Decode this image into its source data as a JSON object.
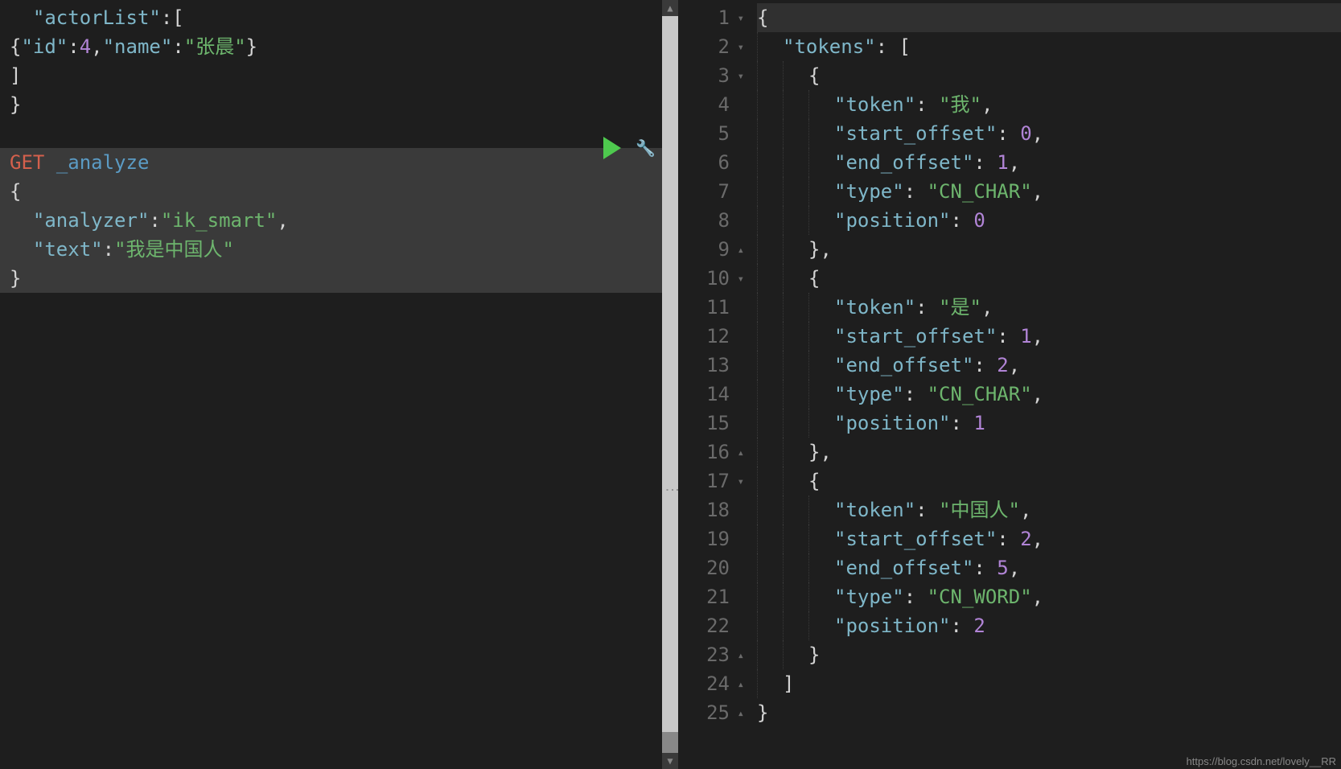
{
  "left": {
    "lines": [
      {
        "type": "plain",
        "segs": [
          {
            "t": "  ",
            "c": "punct"
          },
          {
            "t": "\"actorList\"",
            "c": "key"
          },
          {
            "t": ":[",
            "c": "punct"
          }
        ]
      },
      {
        "type": "plain",
        "segs": [
          {
            "t": "{",
            "c": "punct"
          },
          {
            "t": "\"id\"",
            "c": "key"
          },
          {
            "t": ":",
            "c": "punct"
          },
          {
            "t": "4",
            "c": "number"
          },
          {
            "t": ",",
            "c": "punct"
          },
          {
            "t": "\"name\"",
            "c": "key"
          },
          {
            "t": ":",
            "c": "punct"
          },
          {
            "t": "\"张晨\"",
            "c": "string-val"
          },
          {
            "t": "}",
            "c": "punct"
          }
        ]
      },
      {
        "type": "plain",
        "segs": [
          {
            "t": "]",
            "c": "punct"
          }
        ]
      },
      {
        "type": "plain",
        "segs": [
          {
            "t": "}",
            "c": "punct"
          }
        ]
      },
      {
        "type": "blank",
        "segs": []
      },
      {
        "type": "action",
        "segs": [
          {
            "t": "GET",
            "c": "method-get"
          },
          {
            "t": " ",
            "c": "punct"
          },
          {
            "t": "_analyze",
            "c": "endpoint"
          }
        ]
      },
      {
        "type": "action",
        "segs": [
          {
            "t": "{",
            "c": "punct"
          }
        ]
      },
      {
        "type": "action",
        "segs": [
          {
            "t": "  ",
            "c": "punct"
          },
          {
            "t": "\"analyzer\"",
            "c": "key"
          },
          {
            "t": ":",
            "c": "punct"
          },
          {
            "t": "\"ik_smart\"",
            "c": "string-val"
          },
          {
            "t": ",",
            "c": "punct"
          }
        ]
      },
      {
        "type": "action",
        "segs": [
          {
            "t": "  ",
            "c": "punct"
          },
          {
            "t": "\"text\"",
            "c": "key"
          },
          {
            "t": ":",
            "c": "punct"
          },
          {
            "t": "\"我是中国人\"",
            "c": "string-val"
          }
        ]
      },
      {
        "type": "action",
        "segs": [
          {
            "t": "}",
            "c": "punct"
          }
        ]
      }
    ]
  },
  "right": {
    "lines": [
      {
        "n": 1,
        "fold": "down",
        "hl": true,
        "ind": 0,
        "segs": [
          {
            "t": "{",
            "c": "punct"
          }
        ]
      },
      {
        "n": 2,
        "fold": "down",
        "ind": 1,
        "segs": [
          {
            "t": "\"tokens\"",
            "c": "key"
          },
          {
            "t": ": [",
            "c": "punct"
          }
        ]
      },
      {
        "n": 3,
        "fold": "down",
        "ind": 2,
        "segs": [
          {
            "t": "{",
            "c": "punct"
          }
        ]
      },
      {
        "n": 4,
        "fold": "",
        "ind": 3,
        "segs": [
          {
            "t": "\"token\"",
            "c": "key"
          },
          {
            "t": ": ",
            "c": "punct"
          },
          {
            "t": "\"我\"",
            "c": "string-val"
          },
          {
            "t": ",",
            "c": "punct"
          }
        ]
      },
      {
        "n": 5,
        "fold": "",
        "ind": 3,
        "segs": [
          {
            "t": "\"start_offset\"",
            "c": "key"
          },
          {
            "t": ": ",
            "c": "punct"
          },
          {
            "t": "0",
            "c": "number"
          },
          {
            "t": ",",
            "c": "punct"
          }
        ]
      },
      {
        "n": 6,
        "fold": "",
        "ind": 3,
        "segs": [
          {
            "t": "\"end_offset\"",
            "c": "key"
          },
          {
            "t": ": ",
            "c": "punct"
          },
          {
            "t": "1",
            "c": "number"
          },
          {
            "t": ",",
            "c": "punct"
          }
        ]
      },
      {
        "n": 7,
        "fold": "",
        "ind": 3,
        "segs": [
          {
            "t": "\"type\"",
            "c": "key"
          },
          {
            "t": ": ",
            "c": "punct"
          },
          {
            "t": "\"CN_CHAR\"",
            "c": "string-val"
          },
          {
            "t": ",",
            "c": "punct"
          }
        ]
      },
      {
        "n": 8,
        "fold": "",
        "ind": 3,
        "segs": [
          {
            "t": "\"position\"",
            "c": "key"
          },
          {
            "t": ": ",
            "c": "punct"
          },
          {
            "t": "0",
            "c": "number"
          }
        ]
      },
      {
        "n": 9,
        "fold": "up",
        "ind": 2,
        "segs": [
          {
            "t": "},",
            "c": "punct"
          }
        ]
      },
      {
        "n": 10,
        "fold": "down",
        "ind": 2,
        "segs": [
          {
            "t": "{",
            "c": "punct"
          }
        ]
      },
      {
        "n": 11,
        "fold": "",
        "ind": 3,
        "segs": [
          {
            "t": "\"token\"",
            "c": "key"
          },
          {
            "t": ": ",
            "c": "punct"
          },
          {
            "t": "\"是\"",
            "c": "string-val"
          },
          {
            "t": ",",
            "c": "punct"
          }
        ]
      },
      {
        "n": 12,
        "fold": "",
        "ind": 3,
        "segs": [
          {
            "t": "\"start_offset\"",
            "c": "key"
          },
          {
            "t": ": ",
            "c": "punct"
          },
          {
            "t": "1",
            "c": "number"
          },
          {
            "t": ",",
            "c": "punct"
          }
        ]
      },
      {
        "n": 13,
        "fold": "",
        "ind": 3,
        "segs": [
          {
            "t": "\"end_offset\"",
            "c": "key"
          },
          {
            "t": ": ",
            "c": "punct"
          },
          {
            "t": "2",
            "c": "number"
          },
          {
            "t": ",",
            "c": "punct"
          }
        ]
      },
      {
        "n": 14,
        "fold": "",
        "ind": 3,
        "segs": [
          {
            "t": "\"type\"",
            "c": "key"
          },
          {
            "t": ": ",
            "c": "punct"
          },
          {
            "t": "\"CN_CHAR\"",
            "c": "string-val"
          },
          {
            "t": ",",
            "c": "punct"
          }
        ]
      },
      {
        "n": 15,
        "fold": "",
        "ind": 3,
        "segs": [
          {
            "t": "\"position\"",
            "c": "key"
          },
          {
            "t": ": ",
            "c": "punct"
          },
          {
            "t": "1",
            "c": "number"
          }
        ]
      },
      {
        "n": 16,
        "fold": "up",
        "ind": 2,
        "segs": [
          {
            "t": "},",
            "c": "punct"
          }
        ]
      },
      {
        "n": 17,
        "fold": "down",
        "ind": 2,
        "segs": [
          {
            "t": "{",
            "c": "punct"
          }
        ]
      },
      {
        "n": 18,
        "fold": "",
        "ind": 3,
        "segs": [
          {
            "t": "\"token\"",
            "c": "key"
          },
          {
            "t": ": ",
            "c": "punct"
          },
          {
            "t": "\"中国人\"",
            "c": "string-val"
          },
          {
            "t": ",",
            "c": "punct"
          }
        ]
      },
      {
        "n": 19,
        "fold": "",
        "ind": 3,
        "segs": [
          {
            "t": "\"start_offset\"",
            "c": "key"
          },
          {
            "t": ": ",
            "c": "punct"
          },
          {
            "t": "2",
            "c": "number"
          },
          {
            "t": ",",
            "c": "punct"
          }
        ]
      },
      {
        "n": 20,
        "fold": "",
        "ind": 3,
        "segs": [
          {
            "t": "\"end_offset\"",
            "c": "key"
          },
          {
            "t": ": ",
            "c": "punct"
          },
          {
            "t": "5",
            "c": "number"
          },
          {
            "t": ",",
            "c": "punct"
          }
        ]
      },
      {
        "n": 21,
        "fold": "",
        "ind": 3,
        "segs": [
          {
            "t": "\"type\"",
            "c": "key"
          },
          {
            "t": ": ",
            "c": "punct"
          },
          {
            "t": "\"CN_WORD\"",
            "c": "string-val"
          },
          {
            "t": ",",
            "c": "punct"
          }
        ]
      },
      {
        "n": 22,
        "fold": "",
        "ind": 3,
        "segs": [
          {
            "t": "\"position\"",
            "c": "key"
          },
          {
            "t": ": ",
            "c": "punct"
          },
          {
            "t": "2",
            "c": "number"
          }
        ]
      },
      {
        "n": 23,
        "fold": "up",
        "ind": 2,
        "segs": [
          {
            "t": "}",
            "c": "punct"
          }
        ]
      },
      {
        "n": 24,
        "fold": "up",
        "ind": 1,
        "segs": [
          {
            "t": "]",
            "c": "punct"
          }
        ]
      },
      {
        "n": 25,
        "fold": "up",
        "ind": 0,
        "segs": [
          {
            "t": "}",
            "c": "punct"
          }
        ]
      }
    ]
  },
  "watermark": "https://blog.csdn.net/lovely__RR",
  "icons": {
    "scroll_up": "▲",
    "scroll_down": "▼",
    "fold_down": "▾",
    "fold_up": "▴",
    "wrench": "🔧",
    "drag": "⋮"
  }
}
